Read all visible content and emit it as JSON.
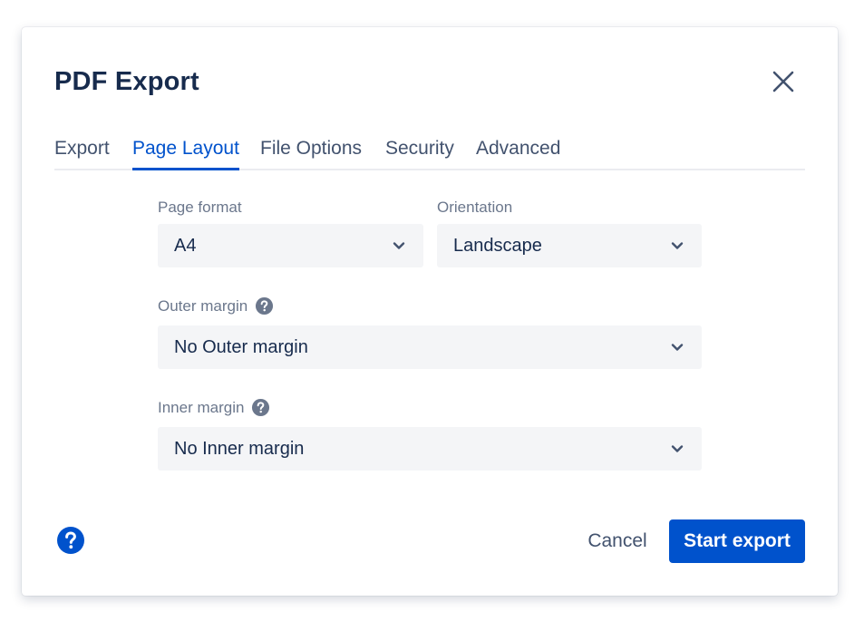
{
  "dialog": {
    "title": "PDF Export",
    "close_icon": "close-icon"
  },
  "tabs": [
    {
      "label": "Export",
      "active": false
    },
    {
      "label": "Page Layout",
      "active": true
    },
    {
      "label": "File Options",
      "active": false
    },
    {
      "label": "Security",
      "active": false
    },
    {
      "label": "Advanced",
      "active": false
    }
  ],
  "form": {
    "page_format": {
      "label": "Page format",
      "value": "A4"
    },
    "orientation": {
      "label": "Orientation",
      "value": "Landscape"
    },
    "outer_margin": {
      "label": "Outer margin",
      "value": "No Outer margin",
      "help_icon": "help-icon"
    },
    "inner_margin": {
      "label": "Inner margin",
      "value": "No Inner margin",
      "help_icon": "help-icon"
    }
  },
  "footer": {
    "help_icon": "help-icon",
    "cancel_label": "Cancel",
    "start_label": "Start export"
  },
  "colors": {
    "primary": "#0052cc",
    "text": "#172b4d",
    "muted": "#6b778c",
    "field_bg": "#f4f5f7"
  }
}
